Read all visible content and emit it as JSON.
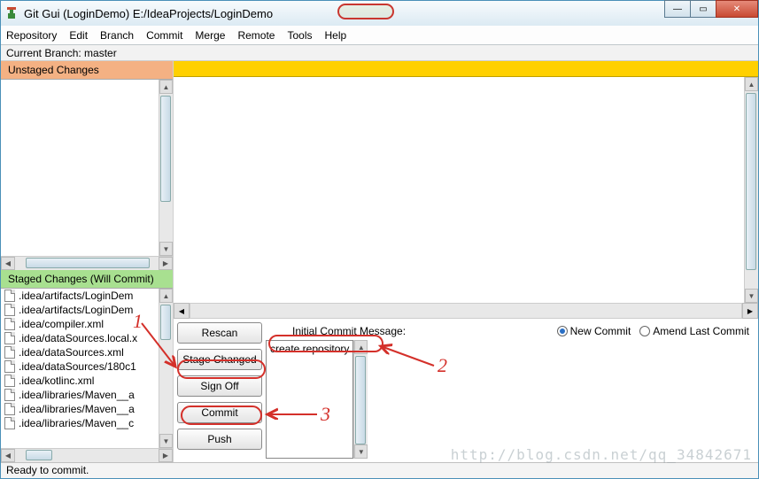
{
  "window": {
    "title": "Git Gui (LoginDemo) E:/IdeaProjects/LoginDemo"
  },
  "menu": [
    "Repository",
    "Edit",
    "Branch",
    "Commit",
    "Merge",
    "Remote",
    "Tools",
    "Help"
  ],
  "branch_line": "Current Branch: master",
  "panels": {
    "unstaged": "Unstaged Changes",
    "staged": "Staged Changes (Will Commit)"
  },
  "staged_files": [
    ".idea/artifacts/LoginDem",
    ".idea/artifacts/LoginDem",
    ".idea/compiler.xml",
    ".idea/dataSources.local.x",
    ".idea/dataSources.xml",
    ".idea/dataSources/180c1",
    ".idea/kotlinc.xml",
    ".idea/libraries/Maven__a",
    ".idea/libraries/Maven__a",
    ".idea/libraries/Maven__c"
  ],
  "buttons": {
    "rescan": "Rescan",
    "stage": "Stage Changed",
    "signoff": "Sign Off",
    "commit": "Commit",
    "push": "Push"
  },
  "commit": {
    "label": "Initial Commit Message:",
    "message": "create repository",
    "new_commit": "New Commit",
    "amend": "Amend Last Commit"
  },
  "status": "Ready to commit.",
  "annotations": {
    "n1": "1",
    "n2": "2",
    "n3": "3"
  },
  "watermark": "http://blog.csdn.net/qq_34842671"
}
